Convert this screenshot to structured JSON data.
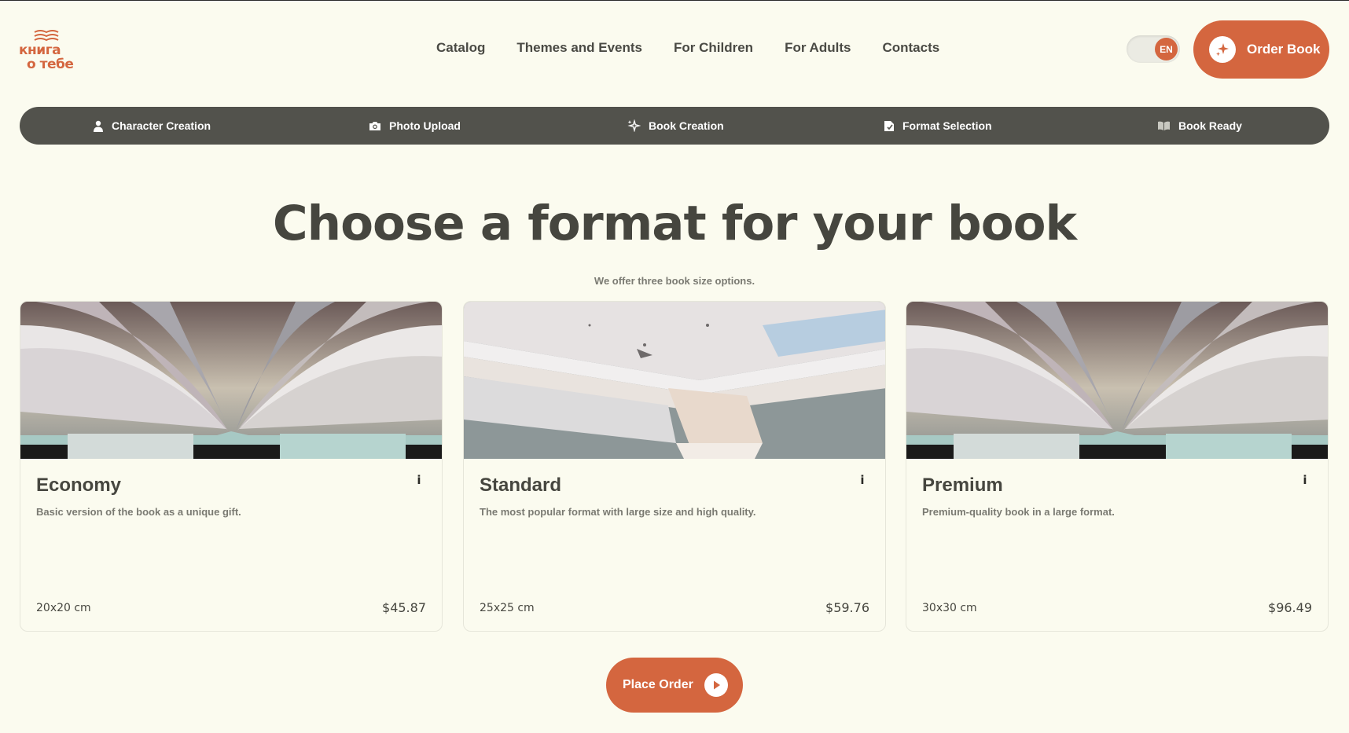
{
  "brand": {
    "line1": "книга",
    "line2": "о тебе",
    "accent": "#d4663f"
  },
  "nav": {
    "items": [
      "Catalog",
      "Themes and Events",
      "For Children",
      "For Adults",
      "Contacts"
    ]
  },
  "language": {
    "current": "EN"
  },
  "header": {
    "order_button": "Order Book"
  },
  "steps": [
    {
      "label": "Character Creation",
      "icon": "person-icon"
    },
    {
      "label": "Photo Upload",
      "icon": "camera-icon"
    },
    {
      "label": "Book Creation",
      "icon": "sparkles-icon"
    },
    {
      "label": "Format Selection",
      "icon": "document-icon"
    },
    {
      "label": "Book Ready",
      "icon": "open-book-icon"
    }
  ],
  "main": {
    "title": "Choose a format for your book",
    "subtitle": "We offer three book size options."
  },
  "cards": [
    {
      "name": "Economy",
      "info": "i",
      "description": "Basic version of the book as a unique gift.",
      "size": "20x20 cm",
      "price": "$45.87"
    },
    {
      "name": "Standard",
      "info": "i",
      "description": "The most popular format with large size and high quality.",
      "size": "25x25 cm",
      "price": "$59.76"
    },
    {
      "name": "Premium",
      "info": "i",
      "description": "Premium-quality book in a large format.",
      "size": "30x30 cm",
      "price": "$96.49"
    }
  ],
  "footer": {
    "place_order": "Place Order"
  },
  "colors": {
    "background": "#fbfbef",
    "steps_bar": "#52524c",
    "accent": "#d4663f"
  }
}
